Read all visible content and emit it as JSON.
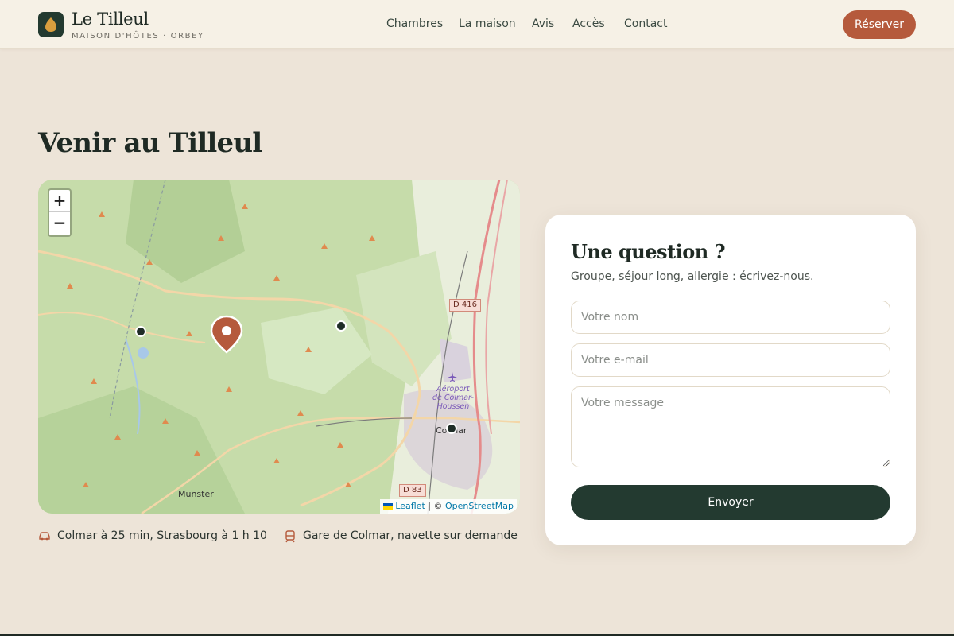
{
  "header": {
    "brand_name": "Le Tilleul",
    "brand_sub": "MAISON D'HÔTES · ORBEY",
    "nav": [
      "Chambres",
      "La maison",
      "Avis",
      "Accès",
      "Contact"
    ],
    "cta": "Réserver"
  },
  "access": {
    "title": "Venir au Tilleul",
    "map": {
      "zoom_in": "+",
      "zoom_out": "−",
      "labels": {
        "road_d416": "D 416",
        "road_d83": "D 83",
        "airport": "Aéroport\nde Colmar-\nHoussen",
        "colmar": "Colmar",
        "munster": "Munster"
      },
      "attribution": {
        "leaflet": "Leaflet",
        "sep": " | © ",
        "osm": "OpenStreetMap"
      }
    },
    "info": [
      {
        "icon": "car-icon",
        "text": "Colmar à 25 min, Strasbourg à 1 h 10"
      },
      {
        "icon": "train-icon",
        "text": "Gare de Colmar, navette sur demande"
      }
    ]
  },
  "contact": {
    "title": "Une question ?",
    "subtitle": "Groupe, séjour long, allergie : écrivez-nous.",
    "name_placeholder": "Votre nom",
    "email_placeholder": "Votre e-mail",
    "message_placeholder": "Votre message",
    "submit": "Envoyer"
  },
  "colors": {
    "accent": "#b55a3c",
    "dark": "#233a30",
    "background": "#ede4d8"
  }
}
